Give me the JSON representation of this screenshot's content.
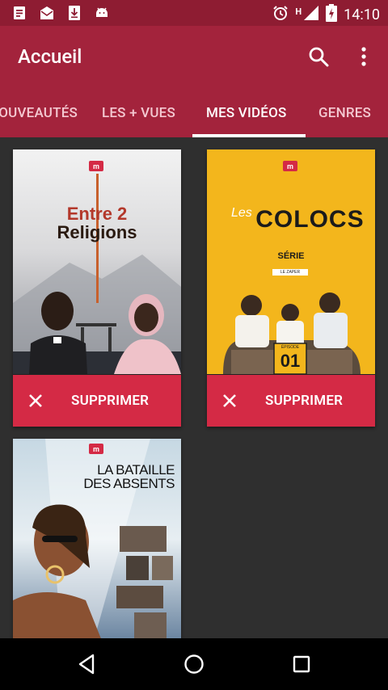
{
  "status_bar": {
    "time": "14:10",
    "network": "H",
    "icons": [
      "doc-icon",
      "mail-icon",
      "download-icon",
      "android-icon",
      "alarm-icon",
      "signal-icon",
      "battery-icon"
    ]
  },
  "app_bar": {
    "title": "Accueil",
    "actions": [
      "search-icon",
      "more-vert-icon"
    ]
  },
  "tabs": [
    "NOUVEAUTÉS",
    "LES + VUES",
    "MES VIDÉOS",
    "GENRES"
  ],
  "active_tab": "MES VIDÉOS",
  "videos": [
    {
      "title_line1": "Entre 2",
      "title_line2": "Religions",
      "action": "SUPPRIMER"
    },
    {
      "title_prefix": "Les",
      "title_main": "Colocs",
      "subtitle": "SÉRIE",
      "episode": "01",
      "small_tag": "LE ZAPER",
      "episode_label": "ÉPISODE",
      "action": "SUPPRIMER"
    },
    {
      "title_line1": "LA BATAILLE",
      "title_line2": "DES ABSENTS"
    }
  ],
  "brand_mark": "m",
  "colors": {
    "accent": "#a3233c",
    "status": "#8e1c32",
    "button": "#d42a45",
    "background": "#2f2f2f"
  }
}
